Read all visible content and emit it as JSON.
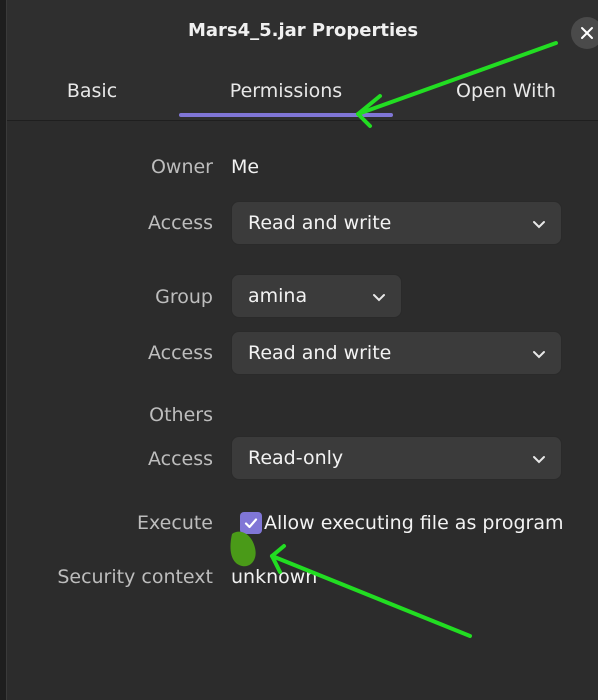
{
  "window": {
    "title": "Mars4_5.jar Properties",
    "close_icon": "close-icon"
  },
  "tabs": [
    {
      "label": "Basic",
      "selected": false
    },
    {
      "label": "Permissions",
      "selected": true
    },
    {
      "label": "Open With",
      "selected": false
    }
  ],
  "permissions": {
    "owner_label": "Owner",
    "owner_value": "Me",
    "owner_access_label": "Access",
    "owner_access_value": "Read and write",
    "group_label": "Group",
    "group_value": "amina",
    "group_access_label": "Access",
    "group_access_value": "Read and write",
    "others_label": "Others",
    "others_access_label": "Access",
    "others_access_value": "Read-only",
    "execute_label": "Execute",
    "execute_checkbox_label": "Allow executing file as program",
    "execute_checked": true,
    "security_label": "Security context",
    "security_value": "unknown"
  },
  "colors": {
    "accent": "#8076d6",
    "annotation": "#22dd22",
    "blob": "#4a9a18"
  }
}
